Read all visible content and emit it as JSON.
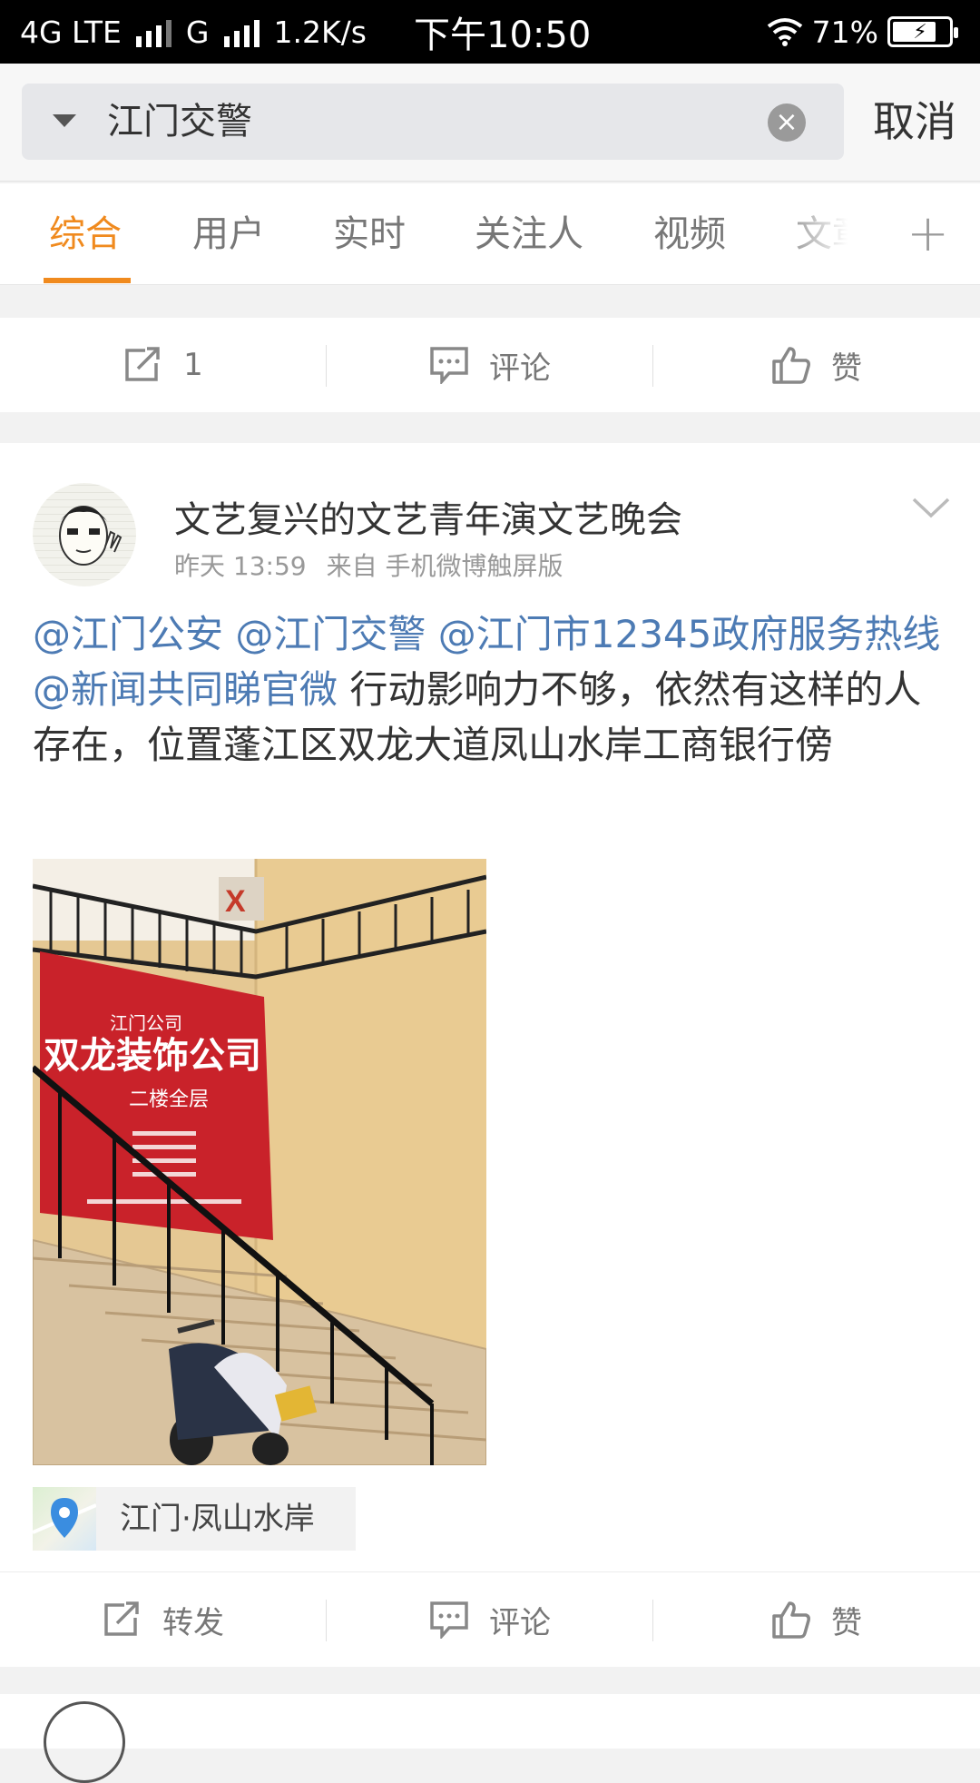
{
  "status_bar": {
    "network": "4G LTE",
    "network2": "G",
    "speed": "1.2K/s",
    "time": "下午10:50",
    "battery": "71%"
  },
  "search": {
    "query": "江门交警",
    "cancel_label": "取消"
  },
  "tabs": [
    "综合",
    "用户",
    "实时",
    "关注人",
    "视频",
    "文章"
  ],
  "tab_add": "+",
  "top_actions": {
    "repost": "1",
    "comment": "评论",
    "like": "赞"
  },
  "post": {
    "author": "文艺复兴的文艺青年演文艺晚会",
    "time": "昨天 13:59",
    "source": "来自 手机微博触屏版",
    "mentions": [
      "@江门公安",
      "@江门交警",
      "@江门市12345政府服务热线",
      "@新闻共同睇官微"
    ],
    "body": "行动影响力不够，依然有这样的人存在，位置蓬江区双龙大道凤山水岸工商银行傍",
    "photo_sign": {
      "company": "双龙装饰公司",
      "branch": "江门公司",
      "floor": "二楼全层"
    },
    "location": "江门·凤山水岸",
    "actions": {
      "repost": "转发",
      "comment": "评论",
      "like": "赞"
    }
  },
  "colors": {
    "accent": "#f08a1e",
    "mention": "#4d7bb4"
  }
}
